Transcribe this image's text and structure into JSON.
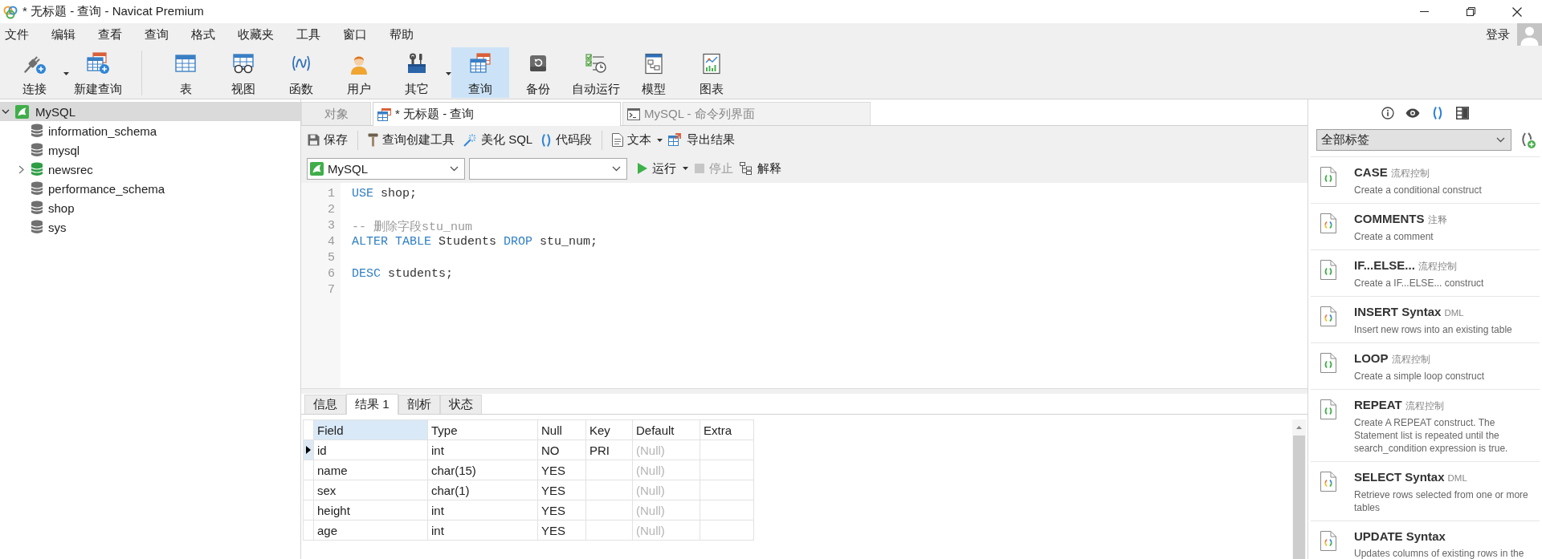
{
  "window": {
    "title": "* 无标题 - 查询 - Navicat Premium"
  },
  "menu": [
    "文件",
    "编辑",
    "查看",
    "查询",
    "格式",
    "收藏夹",
    "工具",
    "窗口",
    "帮助"
  ],
  "account": {
    "label": "登录"
  },
  "toolbar": {
    "connection_group": [
      {
        "label": "连接",
        "dropdown": true,
        "selected": false
      },
      {
        "label": "新建查询",
        "dropdown": false,
        "selected": false
      }
    ],
    "object_group": [
      {
        "label": "表",
        "dropdown": false,
        "selected": false
      },
      {
        "label": "视图",
        "dropdown": false,
        "selected": false
      },
      {
        "label": "函数",
        "dropdown": false,
        "selected": false
      },
      {
        "label": "用户",
        "dropdown": false,
        "selected": false
      },
      {
        "label": "其它",
        "dropdown": true,
        "selected": false
      },
      {
        "label": "查询",
        "dropdown": false,
        "selected": true
      },
      {
        "label": "备份",
        "dropdown": false,
        "selected": false
      },
      {
        "label": "自动运行",
        "dropdown": false,
        "selected": false
      },
      {
        "label": "模型",
        "dropdown": false,
        "selected": false
      },
      {
        "label": "图表",
        "dropdown": false,
        "selected": false
      }
    ]
  },
  "navigator": {
    "connection": {
      "label": "MySQL",
      "expanded": true,
      "selected": true,
      "children": [
        {
          "label": "information_schema",
          "open": false,
          "selected": false
        },
        {
          "label": "mysql",
          "open": false,
          "selected": false
        },
        {
          "label": "newsrec",
          "open": true,
          "selected": false
        },
        {
          "label": "performance_schema",
          "open": false,
          "selected": false
        },
        {
          "label": "shop",
          "open": false,
          "selected": false
        },
        {
          "label": "sys",
          "open": false,
          "selected": false
        }
      ]
    }
  },
  "editor_tabs": [
    {
      "label": "对象",
      "selected": false
    },
    {
      "label": "* 无标题 - 查询",
      "selected": true
    },
    {
      "label": "MySQL - 命令列界面",
      "selected": false
    }
  ],
  "query_toolbar": [
    {
      "items": [
        {
          "label": "保存",
          "dropdown": false
        }
      ]
    },
    {
      "items": [
        {
          "label": "查询创建工具",
          "dropdown": false
        },
        {
          "label": "美化 SQL",
          "dropdown": false
        },
        {
          "label": "代码段",
          "dropdown": false
        }
      ]
    },
    {
      "items": [
        {
          "label": "文本",
          "dropdown": true
        },
        {
          "label": "导出结果",
          "dropdown": false
        }
      ]
    }
  ],
  "run_bar": {
    "connection": "MySQL",
    "actions": [
      {
        "label": "运行",
        "dropdown": true,
        "disabled": false
      },
      {
        "label": "停止",
        "dropdown": false,
        "disabled": true
      },
      {
        "label": "解释",
        "dropdown": false,
        "disabled": false
      }
    ]
  },
  "editor": {
    "lines": [
      {
        "number": "1",
        "tokens": [
          {
            "text": "USE",
            "kind": "keyword"
          },
          {
            "text": " shop;",
            "kind": "plain"
          }
        ]
      },
      {
        "number": "2"
      },
      {
        "number": "3",
        "tokens": [
          {
            "text": "-- 删除字段stu_num",
            "kind": "comment"
          }
        ]
      },
      {
        "number": "4",
        "tokens": [
          {
            "text": "ALTER TABLE",
            "kind": "keyword"
          },
          {
            "text": " Students ",
            "kind": "plain"
          },
          {
            "text": "DROP",
            "kind": "keyword"
          },
          {
            "text": " stu_num;",
            "kind": "plain"
          }
        ]
      },
      {
        "number": "5"
      },
      {
        "number": "6",
        "tokens": [
          {
            "text": "DESC",
            "kind": "keyword"
          },
          {
            "text": " students;",
            "kind": "plain"
          }
        ]
      },
      {
        "number": "7"
      }
    ]
  },
  "result_tabs": [
    {
      "label": "信息",
      "selected": false
    },
    {
      "label": "结果 1",
      "selected": true
    },
    {
      "label": "剖析",
      "selected": false
    },
    {
      "label": "状态",
      "selected": false
    }
  ],
  "result_table": {
    "columns": [
      {
        "label": "Field",
        "selected": true
      },
      {
        "label": "Type",
        "selected": false
      },
      {
        "label": "Null",
        "selected": false
      },
      {
        "label": "Key",
        "selected": false
      },
      {
        "label": "Default",
        "selected": false
      },
      {
        "label": "Extra",
        "selected": false
      }
    ],
    "rows": [
      {
        "selected": true,
        "cells": [
          {
            "text": "id",
            "is_null": false
          },
          {
            "text": "int",
            "is_null": false
          },
          {
            "text": "NO",
            "is_null": false
          },
          {
            "text": "PRI",
            "is_null": false
          },
          {
            "text": "(Null)",
            "is_null": true
          },
          null
        ]
      },
      {
        "selected": false,
        "cells": [
          {
            "text": "name",
            "is_null": false
          },
          {
            "text": "char(15)",
            "is_null": false
          },
          {
            "text": "YES",
            "is_null": false
          },
          null,
          {
            "text": "(Null)",
            "is_null": true
          },
          null
        ]
      },
      {
        "selected": false,
        "cells": [
          {
            "text": "sex",
            "is_null": false
          },
          {
            "text": "char(1)",
            "is_null": false
          },
          {
            "text": "YES",
            "is_null": false
          },
          null,
          {
            "text": "(Null)",
            "is_null": true
          },
          null
        ]
      },
      {
        "selected": false,
        "cells": [
          {
            "text": "height",
            "is_null": false
          },
          {
            "text": "int",
            "is_null": false
          },
          {
            "text": "YES",
            "is_null": false
          },
          null,
          {
            "text": "(Null)",
            "is_null": true
          },
          null
        ]
      },
      {
        "selected": false,
        "cells": [
          {
            "text": "age",
            "is_null": false
          },
          {
            "text": "int",
            "is_null": false
          },
          {
            "text": "YES",
            "is_null": false
          },
          null,
          {
            "text": "(Null)",
            "is_null": true
          },
          null
        ]
      }
    ]
  },
  "snippets_panel": {
    "tabs": [
      {
        "selected": false
      },
      {
        "selected": false
      },
      {
        "selected": true
      },
      {
        "selected": false
      }
    ],
    "filter": "全部标签",
    "items": [
      {
        "title": "CASE",
        "tag": "流程控制",
        "description": "Create a conditional construct",
        "kind": "flow"
      },
      {
        "title": "COMMENTS",
        "tag": "注释",
        "description": "Create a comment",
        "kind": "general"
      },
      {
        "title": "IF...ELSE...",
        "tag": "流程控制",
        "description": "Create a IF...ELSE... construct",
        "kind": "flow"
      },
      {
        "title": "INSERT Syntax",
        "tag": "DML",
        "description": "Insert new rows into an existing table",
        "kind": "general"
      },
      {
        "title": "LOOP",
        "tag": "流程控制",
        "description": "Create a simple loop construct",
        "kind": "flow"
      },
      {
        "title": "REPEAT",
        "tag": "流程控制",
        "description": "Create A REPEAT construct. The Statement list is repeated until the search_condition expression is true.",
        "kind": "flow"
      },
      {
        "title": "SELECT Syntax",
        "tag": "DML",
        "description": "Retrieve rows selected from one or more tables",
        "kind": "general"
      },
      {
        "title": "UPDATE Syntax",
        "description": "Updates columns of existing rows in the",
        "kind": "general"
      }
    ]
  }
}
